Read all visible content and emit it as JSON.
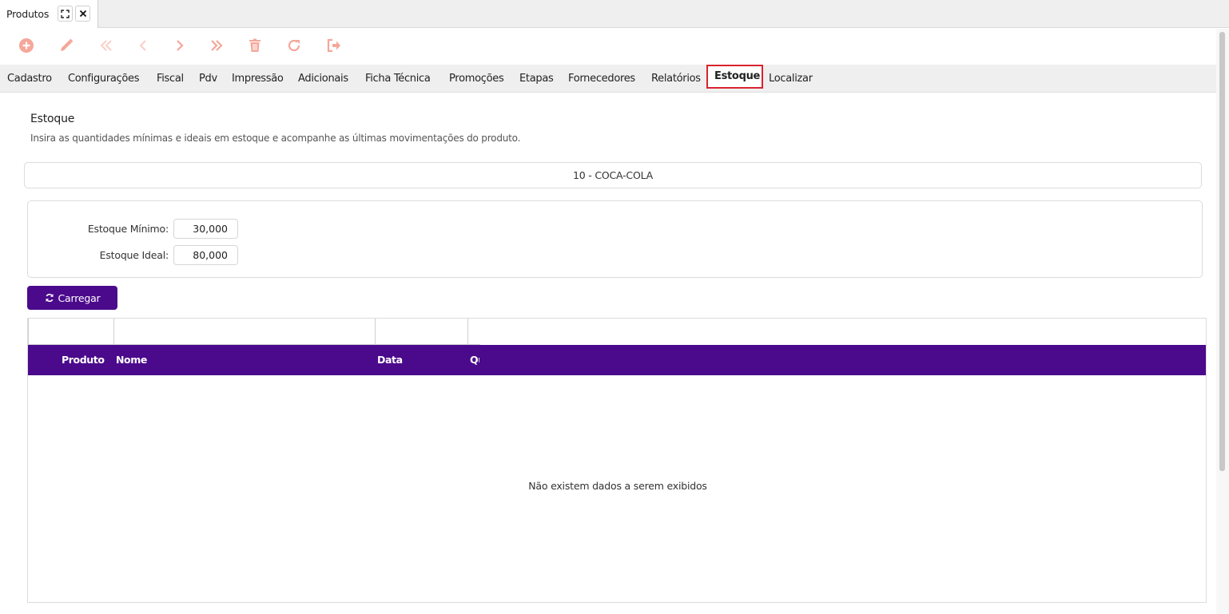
{
  "window": {
    "tab_title": "Produtos"
  },
  "toolbar": {
    "buttons": [
      {
        "name": "add",
        "icon": "plus-circle-icon"
      },
      {
        "name": "edit",
        "icon": "pencil-icon"
      },
      {
        "name": "first",
        "icon": "double-chevron-left-icon"
      },
      {
        "name": "previous",
        "icon": "chevron-left-icon"
      },
      {
        "name": "next",
        "icon": "chevron-right-icon"
      },
      {
        "name": "last",
        "icon": "double-chevron-right-icon"
      },
      {
        "name": "delete",
        "icon": "trash-icon"
      },
      {
        "name": "refresh",
        "icon": "refresh-icon"
      },
      {
        "name": "exit",
        "icon": "sign-out-icon"
      }
    ],
    "icon_color": "#f4a79a"
  },
  "nav_tabs": [
    "Cadastro",
    "Configurações",
    "Fiscal",
    "Pdv",
    "Impressão",
    "Adicionais",
    "Ficha Técnica",
    "Promoções",
    "Etapas",
    "Fornecedores",
    "Relatórios",
    "Estoque",
    "Localizar"
  ],
  "active_tab": "Estoque",
  "section": {
    "title": "Estoque",
    "description": "Insira as quantidades mínimas e ideais em estoque e acompanhe as últimas movimentações do produto."
  },
  "product": {
    "label": "10 - COCA-COLA"
  },
  "stock": {
    "min_label": "Estoque Mínimo:",
    "min_value": "30,000",
    "ideal_label": "Estoque Ideal:",
    "ideal_value": "80,000"
  },
  "load_button": {
    "label": "Carregar"
  },
  "grid": {
    "columns": [
      "Produto",
      "Nome",
      "Data",
      "Qu"
    ],
    "empty_message": "Não existem dados a serem exibidos"
  },
  "colors": {
    "accent": "#4b0a8c",
    "active_tab_border": "#d9232e"
  }
}
